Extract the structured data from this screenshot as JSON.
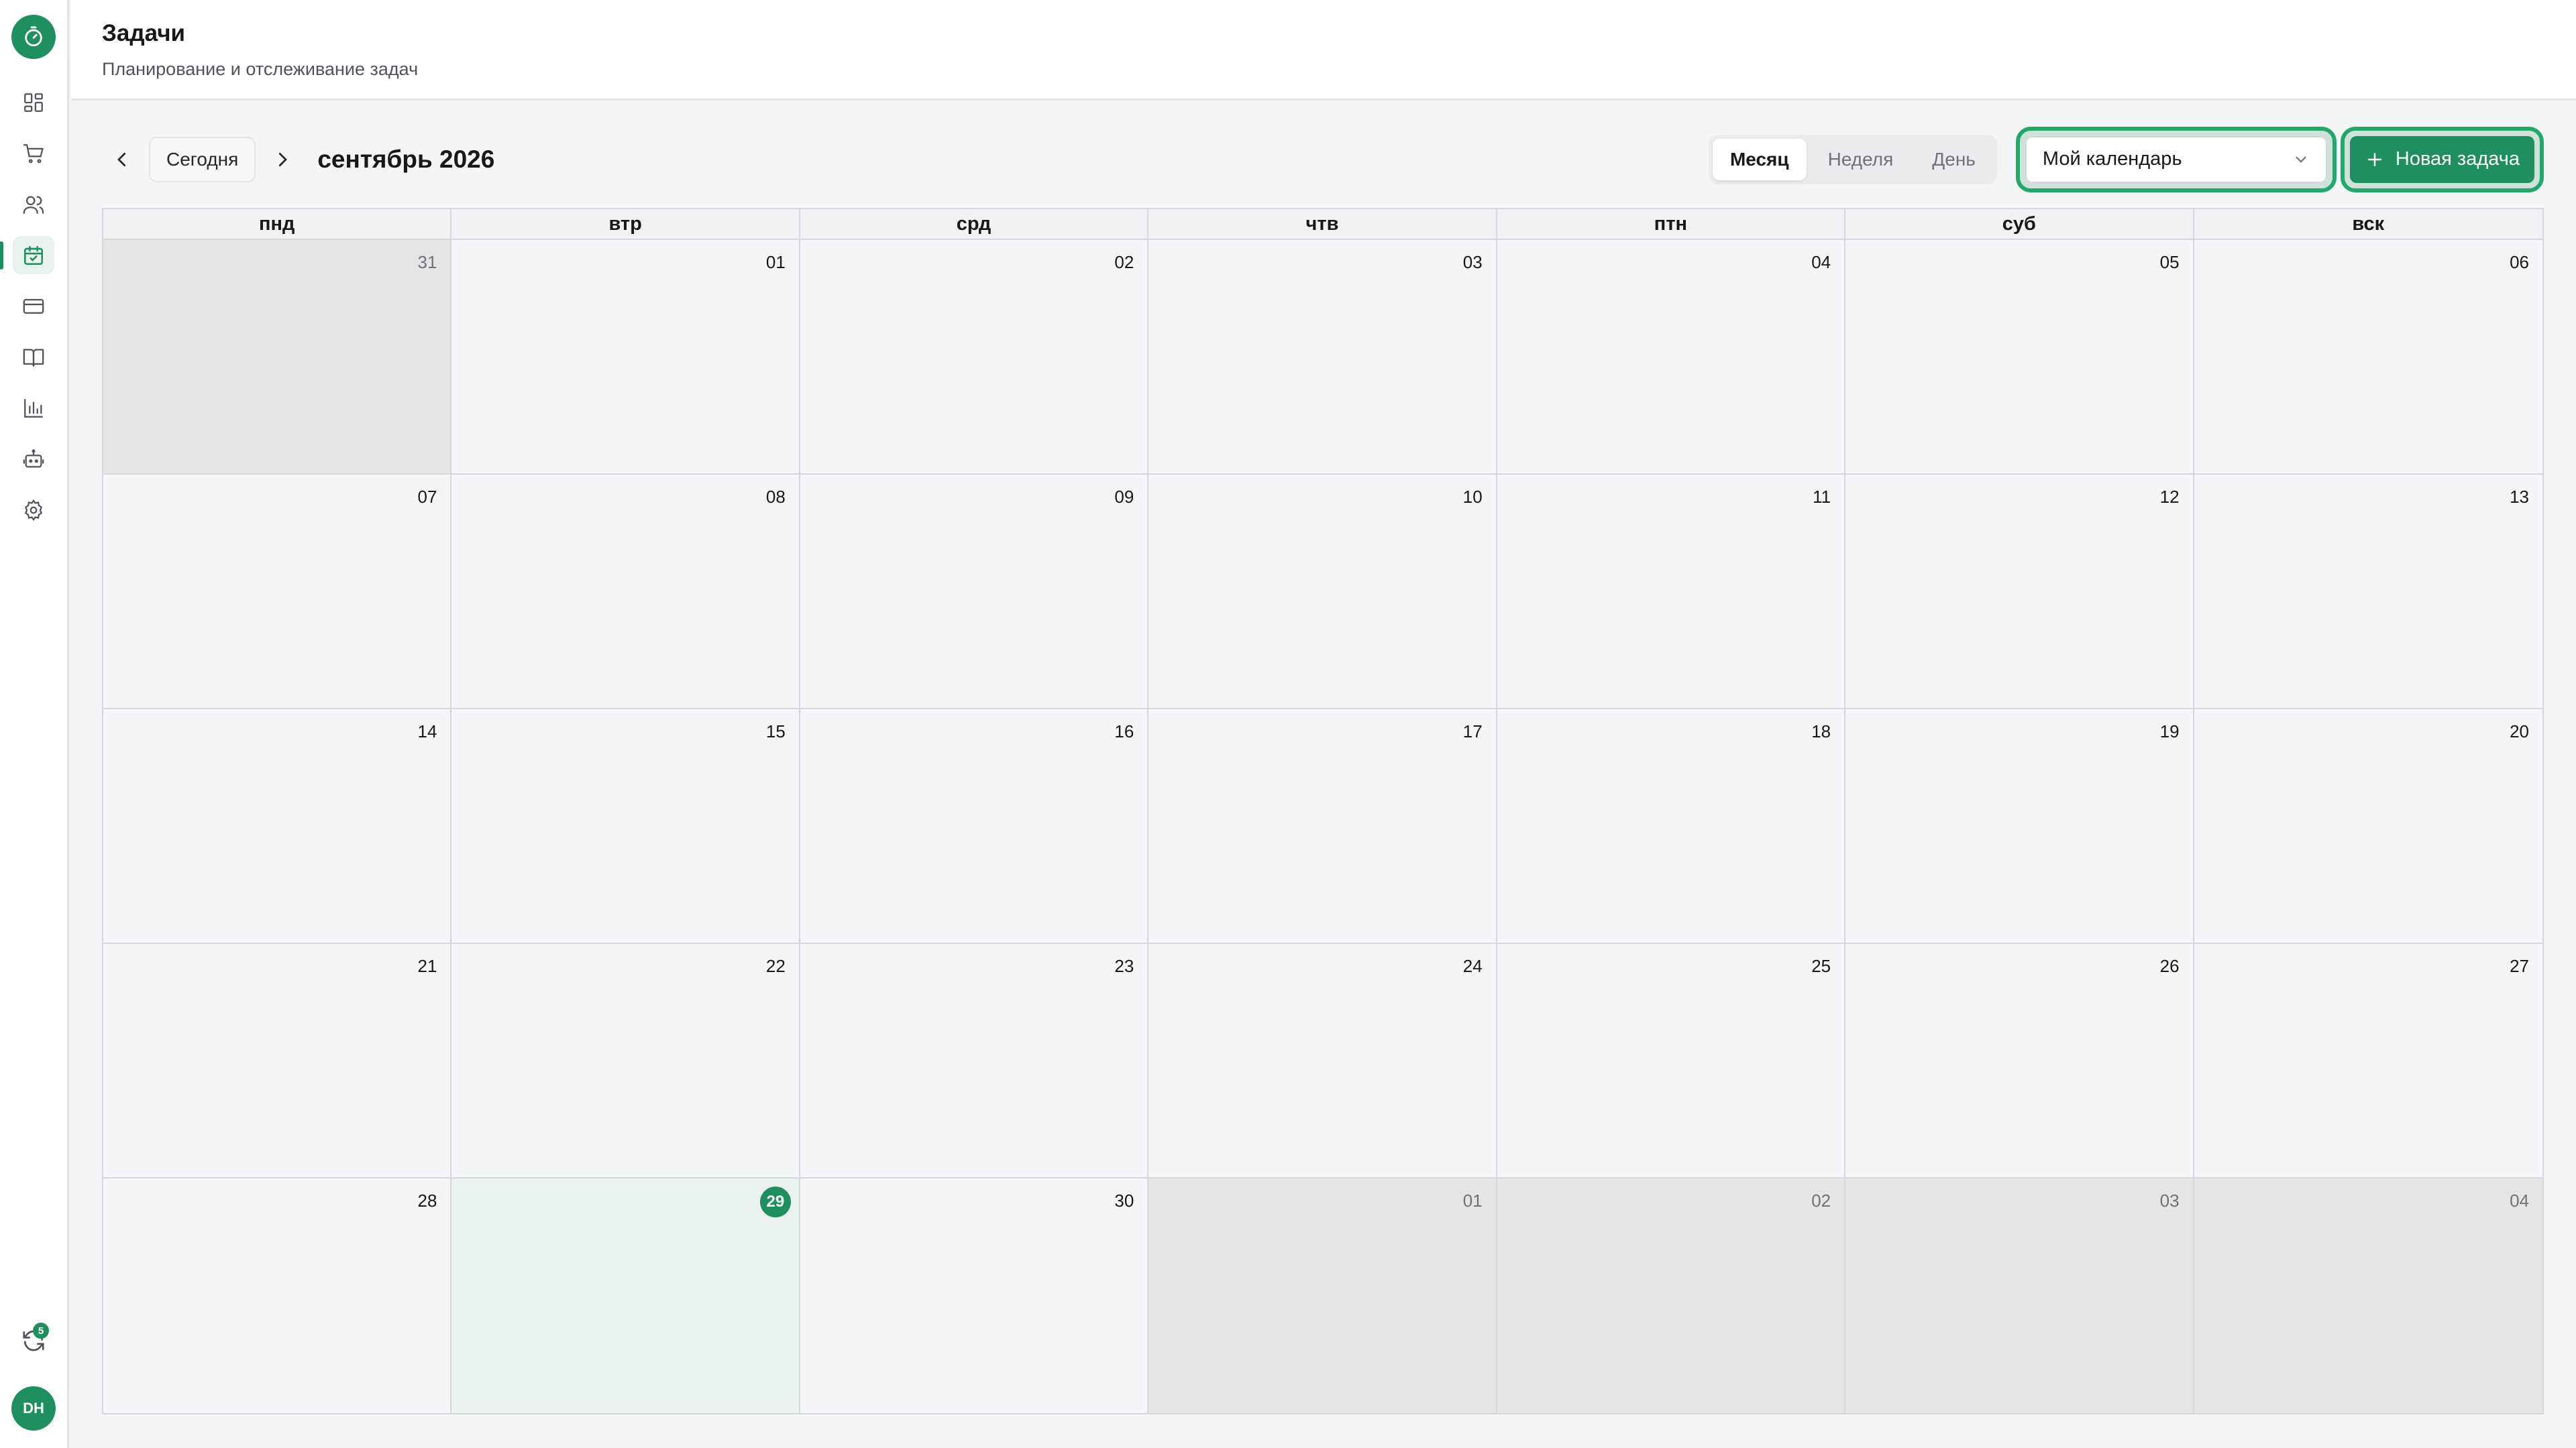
{
  "sidebar": {
    "logo": "timer-logo",
    "items": [
      {
        "icon": "dashboard-icon",
        "active": false
      },
      {
        "icon": "cart-icon",
        "active": false
      },
      {
        "icon": "users-icon",
        "active": false
      },
      {
        "icon": "calendar-check-icon",
        "active": true
      },
      {
        "icon": "card-icon",
        "active": false
      },
      {
        "icon": "book-icon",
        "active": false
      },
      {
        "icon": "chart-icon",
        "active": false
      },
      {
        "icon": "bot-icon",
        "active": false
      },
      {
        "icon": "gear-icon",
        "active": false
      }
    ],
    "sync_badge": "5",
    "avatar": "DH"
  },
  "header": {
    "title": "Задачи",
    "subtitle": "Планирование и отслеживание задач"
  },
  "toolbar": {
    "today": "Сегодня",
    "month": "сентябрь 2026",
    "views": [
      "Месяц",
      "Неделя",
      "День"
    ],
    "active_view": "Месяц",
    "calendar_select": "Мой календарь",
    "new_task": "Новая задача"
  },
  "calendar": {
    "weekdays": [
      "пнд",
      "втр",
      "срд",
      "чтв",
      "птн",
      "суб",
      "вск"
    ],
    "days": [
      {
        "n": "31",
        "outside": true
      },
      {
        "n": "01"
      },
      {
        "n": "02"
      },
      {
        "n": "03"
      },
      {
        "n": "04"
      },
      {
        "n": "05"
      },
      {
        "n": "06"
      },
      {
        "n": "07"
      },
      {
        "n": "08"
      },
      {
        "n": "09"
      },
      {
        "n": "10"
      },
      {
        "n": "11"
      },
      {
        "n": "12"
      },
      {
        "n": "13"
      },
      {
        "n": "14"
      },
      {
        "n": "15"
      },
      {
        "n": "16"
      },
      {
        "n": "17"
      },
      {
        "n": "18"
      },
      {
        "n": "19"
      },
      {
        "n": "20"
      },
      {
        "n": "21"
      },
      {
        "n": "22"
      },
      {
        "n": "23"
      },
      {
        "n": "24"
      },
      {
        "n": "25"
      },
      {
        "n": "26"
      },
      {
        "n": "27"
      },
      {
        "n": "28"
      },
      {
        "n": "29",
        "today": true
      },
      {
        "n": "30"
      },
      {
        "n": "01",
        "outside": true
      },
      {
        "n": "02",
        "outside": true
      },
      {
        "n": "03",
        "outside": true
      },
      {
        "n": "04",
        "outside": true
      }
    ]
  },
  "colors": {
    "accent": "#1f8f5f",
    "highlight": "#23a86a",
    "outside_day": "#e5e5e5",
    "today_bg": "#e9f2ee"
  }
}
